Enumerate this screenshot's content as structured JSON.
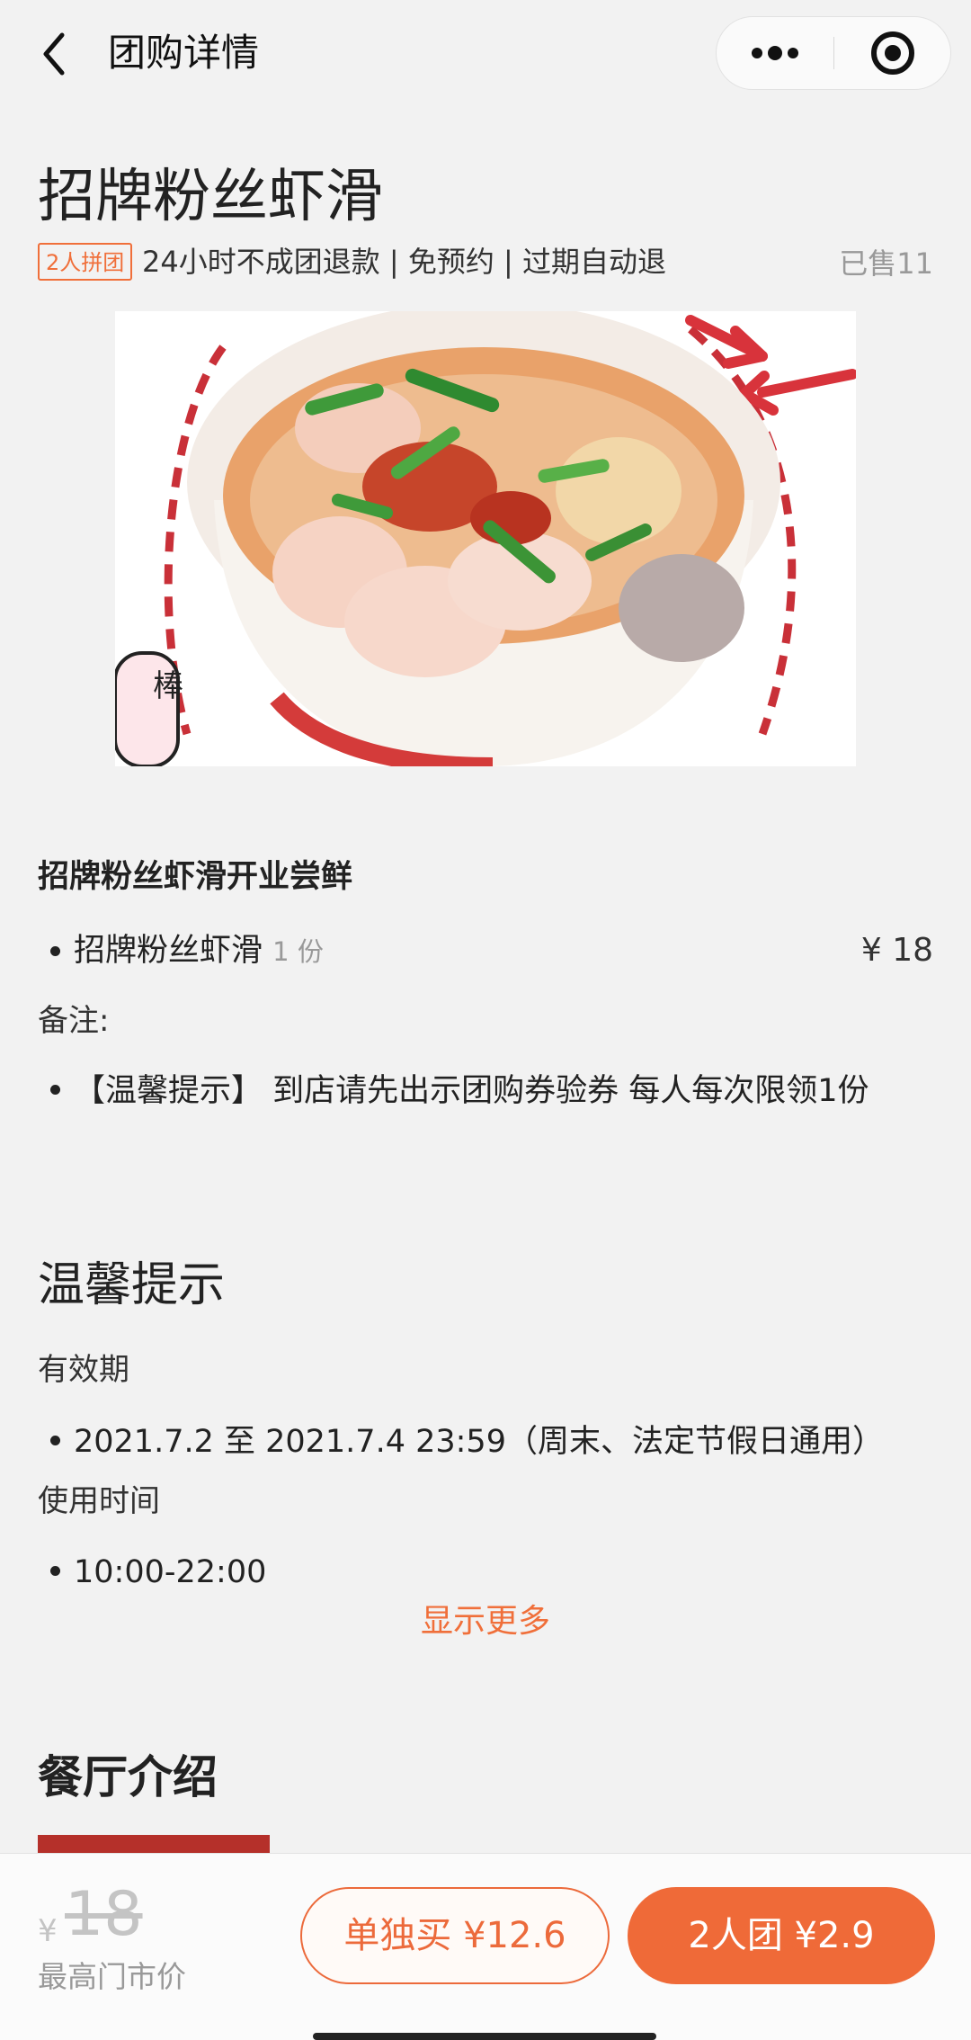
{
  "nav": {
    "title": "团购详情"
  },
  "deal": {
    "title": "招牌粉丝虾滑",
    "badge": "2人拼团",
    "tags": "24小时不成团退款 | 免预约 | 过期自动退",
    "sold": "已售11",
    "photo_text": "棒"
  },
  "package": {
    "subtitle": "招牌粉丝虾滑开业尝鲜",
    "items": [
      {
        "name": "招牌粉丝虾滑",
        "qty": "1 份",
        "price": "¥ 18"
      }
    ],
    "remark_label": "备注:",
    "remark_text": "【温馨提示】 到店请先出示团购券验券 每人每次限领1份"
  },
  "tips": {
    "title": "温馨提示",
    "validity_label": "有效期",
    "validity_text": "2021.7.2 至 2021.7.4 23:59（周末、法定节假日通用）",
    "time_label": "使用时间",
    "time_text": "10:00-22:00",
    "more_link": "显示更多"
  },
  "restaurant": {
    "title": "餐厅介绍"
  },
  "bottom": {
    "currency": "¥",
    "old_price": "18",
    "market_label": "最高门市价",
    "solo_button": "单独买 ¥12.6",
    "group_button": "2人团 ¥2.9"
  },
  "colors": {
    "accent": "#ef6a38",
    "background": "#f2f2f2",
    "muted": "#999999"
  }
}
